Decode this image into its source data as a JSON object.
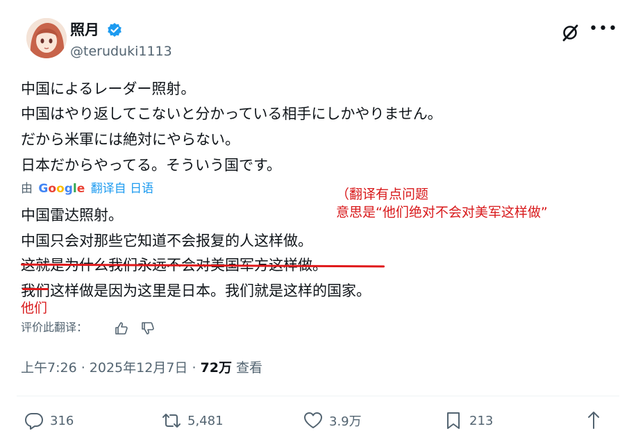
{
  "author": {
    "name": "照月",
    "handle": "@teruduki1113"
  },
  "tweet": {
    "original_lines": [
      "中国によるレーダー照射。",
      "中国はやり返してこないと分かっている相手にしかやりません。",
      "だから米軍には絶対にやらない。",
      "日本だからやってる。そういう国です。"
    ],
    "translated_prefix": "由",
    "translated_brand": "Google",
    "translated_suffix": "翻译自 日语",
    "translation_lines": [
      "中国雷达照射。",
      "中国只会对那些它知道不会报复的人这样做。",
      "这就是为什么我们永远不会对美国军方这样做。",
      "我们这样做是因为这里是日本。我们就是这样的国家。"
    ],
    "rate_label": "评价此翻译："
  },
  "annotations": {
    "note_line1": "（翻译有点问题",
    "note_line2": "意思是“他们绝对不会对美军这样做”",
    "correction": "他们"
  },
  "meta": {
    "time": "上午7:26 · 2025年12月7日 · ",
    "views": "72万",
    "views_label": " 查看"
  },
  "actions": {
    "replies": "316",
    "reposts": "5,481",
    "likes": "3.9万",
    "bookmarks": "213"
  },
  "colors": {
    "link_blue": "#1d9bf0",
    "annotation_red": "#d8191b",
    "muted": "#536471"
  }
}
